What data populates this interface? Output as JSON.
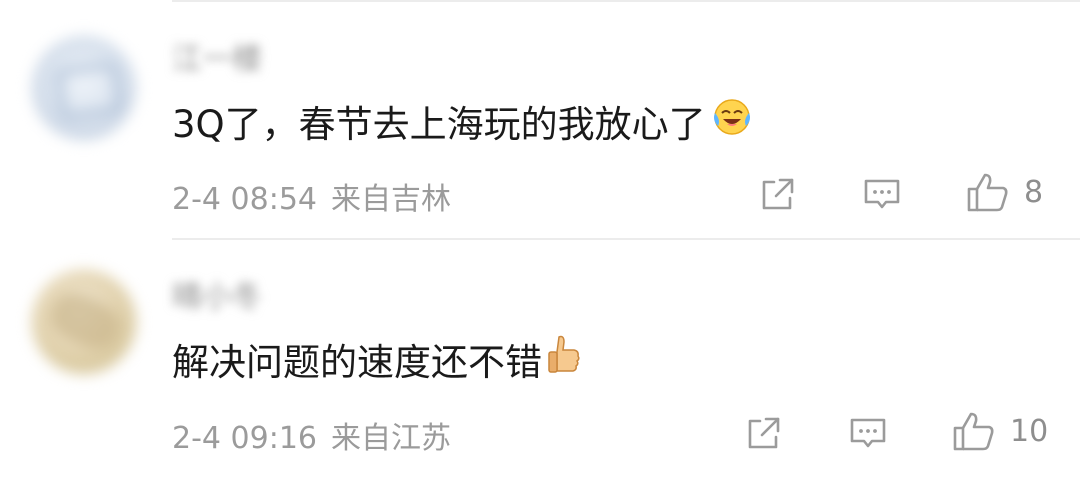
{
  "comments": [
    {
      "username": "江一楼",
      "text": "3Q了，春节去上海玩的我放心了",
      "emoji": "crying-laughing-emoji",
      "time": "2-4 08:54",
      "location": "来自吉林",
      "likes": "8"
    },
    {
      "username": "晴小冬",
      "text": "解决问题的速度还不错",
      "emoji": "thumbs-up-emoji",
      "time": "2-4 09:16",
      "location": "来自江苏",
      "likes": "10"
    }
  ],
  "icons": {
    "share": "share-icon",
    "reply": "comment-icon",
    "like": "thumb-up-icon"
  },
  "colors": {
    "text": "#1a1a1a",
    "meta": "#9b9b9b",
    "divider": "#ececec"
  }
}
